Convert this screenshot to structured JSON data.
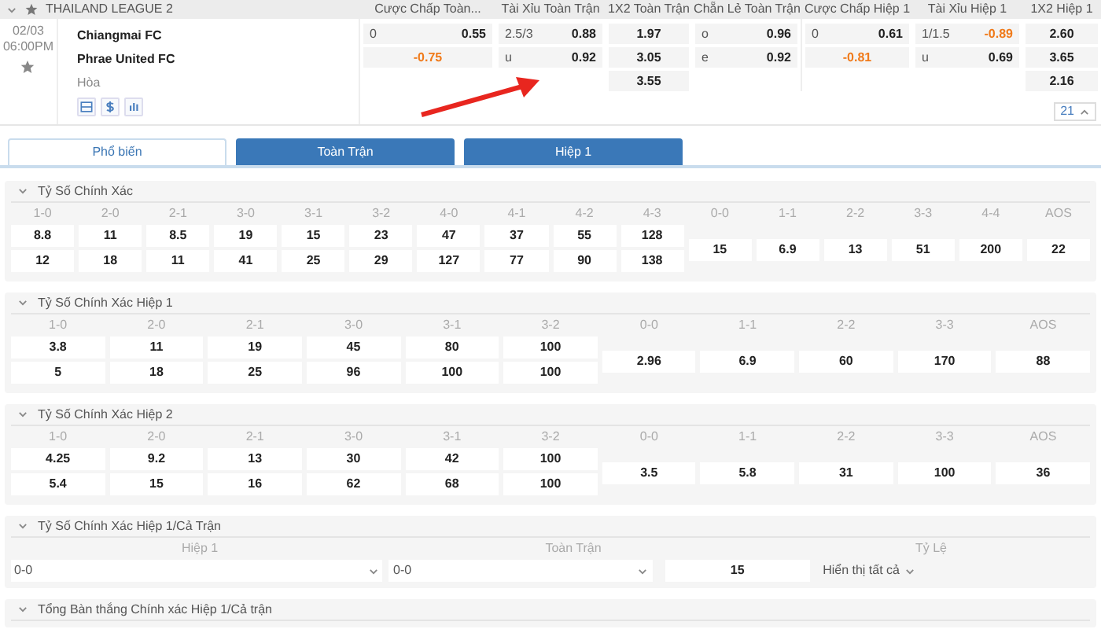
{
  "league": {
    "name": "THAILAND LEAGUE 2",
    "expanded": true
  },
  "market_headers": [
    "Cược Chấp Toàn...",
    "Tài Xỉu Toàn Trận",
    "1X2 Toàn Trận",
    "Chẵn Lẻ Toàn Trận",
    "Cược Chấp Hiệp 1",
    "Tài Xỉu Hiệp 1",
    "1X2 Hiệp 1"
  ],
  "match": {
    "date": "02/03",
    "time": "06:00PM",
    "favorite": false,
    "home": "Chiangmai FC",
    "away": "Phrae United FC",
    "draw": "Hòa",
    "markets": [
      {
        "rows": [
          {
            "label": "0",
            "odds": "0.55",
            "negative": false
          },
          {
            "odds": "-0.75",
            "negative": true
          }
        ]
      },
      {
        "rows": [
          {
            "label": "2.5/3",
            "odds": "0.88",
            "negative": false
          },
          {
            "label": "u",
            "odds": "0.92",
            "negative": false
          }
        ]
      },
      {
        "rows": [
          {
            "odds": "1.97",
            "negative": false
          },
          {
            "odds": "3.05",
            "negative": false
          },
          {
            "odds": "3.55",
            "negative": false
          }
        ]
      },
      {
        "rows": [
          {
            "label": "o",
            "odds": "0.96",
            "negative": false
          },
          {
            "label": "e",
            "odds": "0.92",
            "negative": false
          }
        ]
      },
      {
        "rows": [
          {
            "label": "0",
            "odds": "0.61",
            "negative": false
          },
          {
            "odds": "-0.81",
            "negative": true
          }
        ]
      },
      {
        "rows": [
          {
            "label": "1/1.5",
            "odds": "-0.89",
            "negative": true
          },
          {
            "label": "u",
            "odds": "0.69",
            "negative": false
          }
        ]
      },
      {
        "rows": [
          {
            "odds": "2.60",
            "negative": false
          },
          {
            "odds": "3.65",
            "negative": false
          },
          {
            "odds": "2.16",
            "negative": false
          }
        ]
      }
    ],
    "more_count": "21"
  },
  "tabs": [
    {
      "label": "Phổ biến",
      "selected": true
    },
    {
      "label": "Toàn Trận",
      "selected": false
    },
    {
      "label": "Hiệp 1",
      "selected": false
    }
  ],
  "sections": [
    {
      "kind": "scores",
      "title": "Tỷ Số Chính Xác",
      "expanded": true,
      "columns": [
        {
          "score": "1-0",
          "values": [
            "8.8",
            "12"
          ]
        },
        {
          "score": "2-0",
          "values": [
            "11",
            "18"
          ]
        },
        {
          "score": "2-1",
          "values": [
            "8.5",
            "11"
          ]
        },
        {
          "score": "3-0",
          "values": [
            "19",
            "41"
          ]
        },
        {
          "score": "3-1",
          "values": [
            "15",
            "25"
          ]
        },
        {
          "score": "3-2",
          "values": [
            "23",
            "29"
          ]
        },
        {
          "score": "4-0",
          "values": [
            "47",
            "127"
          ]
        },
        {
          "score": "4-1",
          "values": [
            "37",
            "77"
          ]
        },
        {
          "score": "4-2",
          "values": [
            "55",
            "90"
          ]
        },
        {
          "score": "4-3",
          "values": [
            "128",
            "138"
          ]
        },
        {
          "score": "0-0",
          "values": [
            "15"
          ]
        },
        {
          "score": "1-1",
          "values": [
            "6.9"
          ]
        },
        {
          "score": "2-2",
          "values": [
            "13"
          ]
        },
        {
          "score": "3-3",
          "values": [
            "51"
          ]
        },
        {
          "score": "4-4",
          "values": [
            "200"
          ]
        },
        {
          "score": "AOS",
          "values": [
            "22"
          ]
        }
      ]
    },
    {
      "kind": "scores",
      "title": "Tỷ Số Chính Xác Hiệp 1",
      "expanded": true,
      "columns": [
        {
          "score": "1-0",
          "values": [
            "3.8",
            "5"
          ]
        },
        {
          "score": "2-0",
          "values": [
            "11",
            "18"
          ]
        },
        {
          "score": "2-1",
          "values": [
            "19",
            "25"
          ]
        },
        {
          "score": "3-0",
          "values": [
            "45",
            "96"
          ]
        },
        {
          "score": "3-1",
          "values": [
            "80",
            "100"
          ]
        },
        {
          "score": "3-2",
          "values": [
            "100",
            "100"
          ]
        },
        {
          "score": "0-0",
          "values": [
            "2.96"
          ]
        },
        {
          "score": "1-1",
          "values": [
            "6.9"
          ]
        },
        {
          "score": "2-2",
          "values": [
            "60"
          ]
        },
        {
          "score": "3-3",
          "values": [
            "170"
          ]
        },
        {
          "score": "AOS",
          "values": [
            "88"
          ]
        }
      ]
    },
    {
      "kind": "scores",
      "title": "Tỷ Số Chính Xác Hiệp 2",
      "expanded": true,
      "columns": [
        {
          "score": "1-0",
          "values": [
            "4.25",
            "5.4"
          ]
        },
        {
          "score": "2-0",
          "values": [
            "9.2",
            "15"
          ]
        },
        {
          "score": "2-1",
          "values": [
            "13",
            "16"
          ]
        },
        {
          "score": "3-0",
          "values": [
            "30",
            "62"
          ]
        },
        {
          "score": "3-1",
          "values": [
            "42",
            "68"
          ]
        },
        {
          "score": "3-2",
          "values": [
            "100",
            "100"
          ]
        },
        {
          "score": "0-0",
          "values": [
            "3.5"
          ]
        },
        {
          "score": "1-1",
          "values": [
            "5.8"
          ]
        },
        {
          "score": "2-2",
          "values": [
            "31"
          ]
        },
        {
          "score": "3-3",
          "values": [
            "100"
          ]
        },
        {
          "score": "AOS",
          "values": [
            "36"
          ]
        }
      ]
    },
    {
      "kind": "picker",
      "title": "Tỷ Số Chính Xác Hiệp 1/Cả Trận",
      "expanded": true,
      "first_half": {
        "label": "Hiệp 1",
        "value": "0-0"
      },
      "full_time": {
        "label": "Toàn Trận",
        "value": "0-0"
      },
      "odds": {
        "label": "Tỷ Lệ",
        "value": "15"
      },
      "show_all": "Hiển thị tất cả"
    },
    {
      "kind": "header",
      "title": "Tổng Bàn thắng Chính xác Hiệp 1/Cả trận",
      "expanded": true
    }
  ]
}
